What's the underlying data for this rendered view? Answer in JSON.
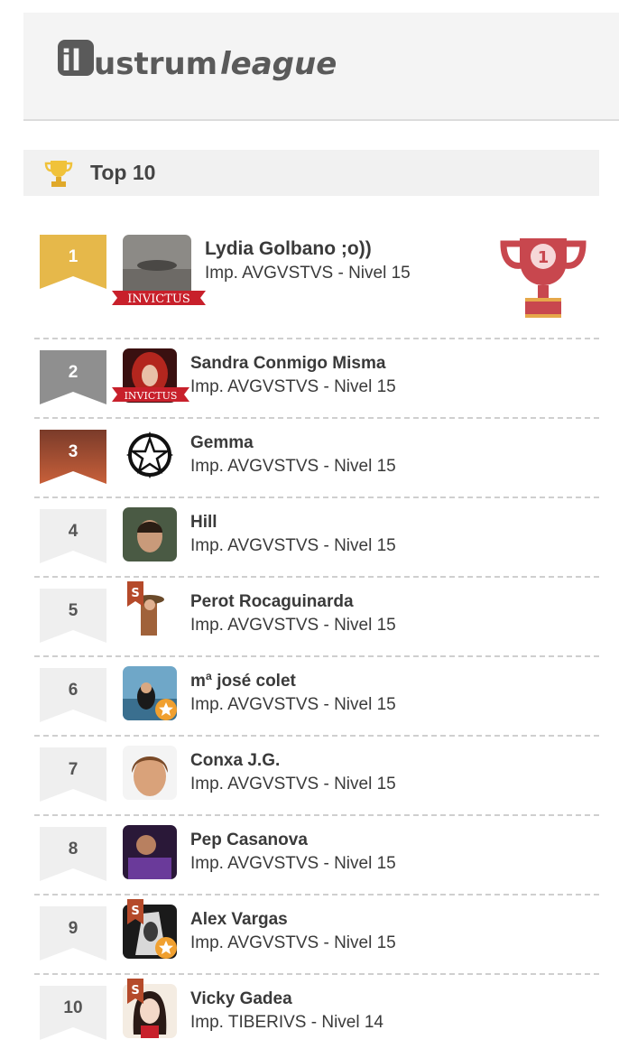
{
  "header": {
    "logo_text": "ilustrum league"
  },
  "section": {
    "title": "Top 10",
    "icon": "trophy-icon"
  },
  "badges": {
    "invictus": "INVICTUS",
    "s": "S"
  },
  "colors": {
    "gold": "#e6b84a",
    "silver": "#8f8f8f",
    "bronze": "#a0553a",
    "cup": "#c8474e"
  },
  "ranking": [
    {
      "rank": "1",
      "name": "Lydia Golbano ;o))",
      "detail": "Imp. AVGVSTVS - Nivel 15",
      "badge": "invictus"
    },
    {
      "rank": "2",
      "name": "Sandra Conmigo Misma",
      "detail": "Imp. AVGVSTVS - Nivel 15",
      "badge": "invictus"
    },
    {
      "rank": "3",
      "name": "Gemma",
      "detail": "Imp. AVGVSTVS - Nivel 15",
      "badge": ""
    },
    {
      "rank": "4",
      "name": "Hill",
      "detail": "Imp. AVGVSTVS - Nivel 15",
      "badge": ""
    },
    {
      "rank": "5",
      "name": "Perot Rocaguinarda",
      "detail": "Imp. AVGVSTVS - Nivel 15",
      "badge": "s"
    },
    {
      "rank": "6",
      "name": "mª josé colet",
      "detail": "Imp. AVGVSTVS - Nivel 15",
      "badge": "star"
    },
    {
      "rank": "7",
      "name": "Conxa J.G.",
      "detail": "Imp. AVGVSTVS - Nivel 15",
      "badge": ""
    },
    {
      "rank": "8",
      "name": "Pep Casanova",
      "detail": "Imp. AVGVSTVS - Nivel 15",
      "badge": ""
    },
    {
      "rank": "9",
      "name": "Alex Vargas",
      "detail": "Imp. AVGVSTVS - Nivel 15",
      "badge": "s+star"
    },
    {
      "rank": "10",
      "name": "Vicky Gadea",
      "detail": "Imp. TIBERIVS - Nivel 14",
      "badge": "s"
    }
  ],
  "first_place_cup": {
    "icon": "cup-icon",
    "number": "1"
  }
}
